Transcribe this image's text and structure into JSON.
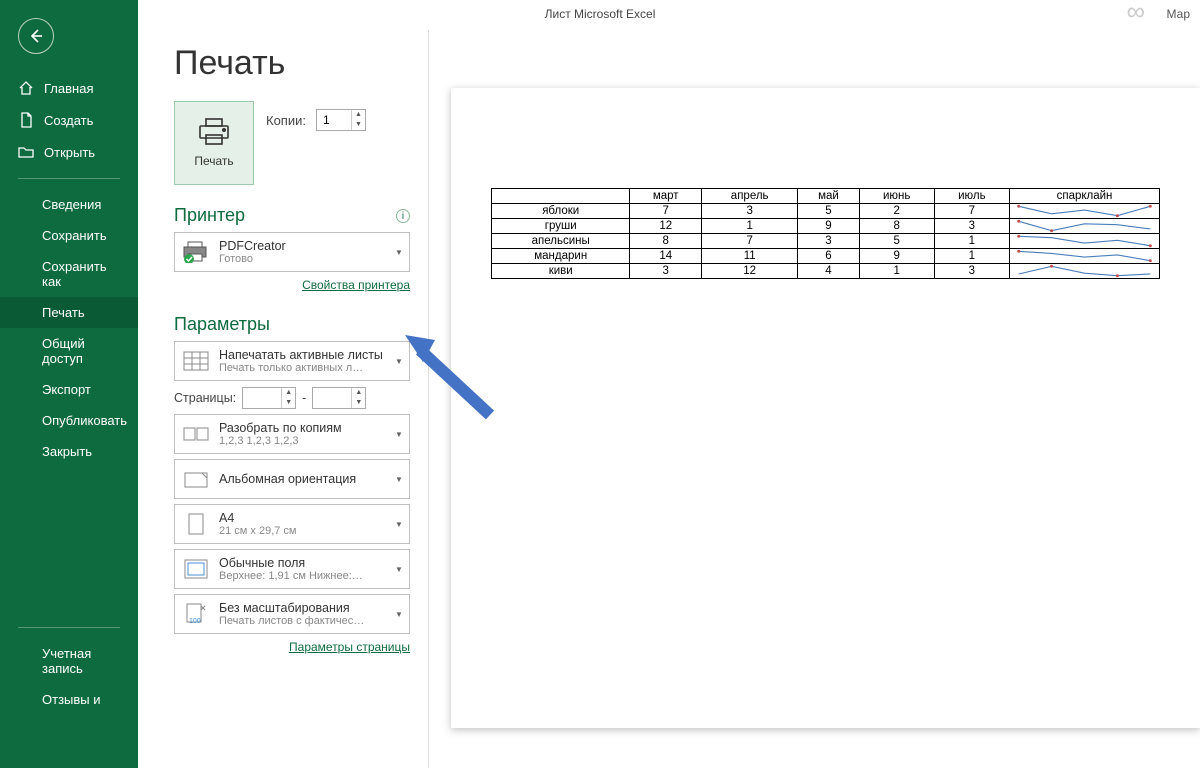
{
  "titlebar": {
    "title": "Лист Microsoft Excel",
    "user": "Мар"
  },
  "sidebar": {
    "home": "Главная",
    "new": "Создать",
    "open": "Открыть",
    "info": "Сведения",
    "save": "Сохранить",
    "saveas": "Сохранить как",
    "print": "Печать",
    "share": "Общий доступ",
    "export": "Экспорт",
    "publish": "Опубликовать",
    "close": "Закрыть",
    "account": "Учетная запись",
    "feedback": "Отзывы и"
  },
  "page": {
    "title": "Печать",
    "print_button": "Печать",
    "copies_label": "Копии:",
    "copies_value": "1"
  },
  "printer": {
    "section": "Принтер",
    "name": "PDFCreator",
    "status": "Готово",
    "props_link": "Свойства принтера"
  },
  "settings": {
    "section": "Параметры",
    "what": {
      "main": "Напечатать активные листы",
      "sub": "Печать только активных л…"
    },
    "pages_label": "Страницы:",
    "pages_sep": "-",
    "collate": {
      "main": "Разобрать по копиям",
      "sub": "1,2,3    1,2,3    1,2,3"
    },
    "orient": {
      "main": "Альбомная ориентация"
    },
    "paper": {
      "main": "A4",
      "sub": "21 см x 29,7 см"
    },
    "margins": {
      "main": "Обычные поля",
      "sub": "Верхнее: 1,91 см Нижнее:…"
    },
    "scale": {
      "main": "Без масштабирования",
      "sub": "Печать листов с фактичес…"
    },
    "page_setup_link": "Параметры страницы"
  },
  "chart_data": {
    "type": "table",
    "columns": [
      "",
      "март",
      "апрель",
      "май",
      "июнь",
      "июль",
      "спарклайн"
    ],
    "rows": [
      {
        "name": "яблоки",
        "values": [
          7,
          3,
          5,
          2,
          7
        ]
      },
      {
        "name": "груши",
        "values": [
          12,
          1,
          9,
          8,
          3
        ]
      },
      {
        "name": "апельсины",
        "values": [
          8,
          7,
          3,
          5,
          1
        ]
      },
      {
        "name": "мандарин",
        "values": [
          14,
          11,
          6,
          9,
          1
        ]
      },
      {
        "name": "киви",
        "values": [
          3,
          12,
          4,
          1,
          3
        ]
      }
    ]
  }
}
